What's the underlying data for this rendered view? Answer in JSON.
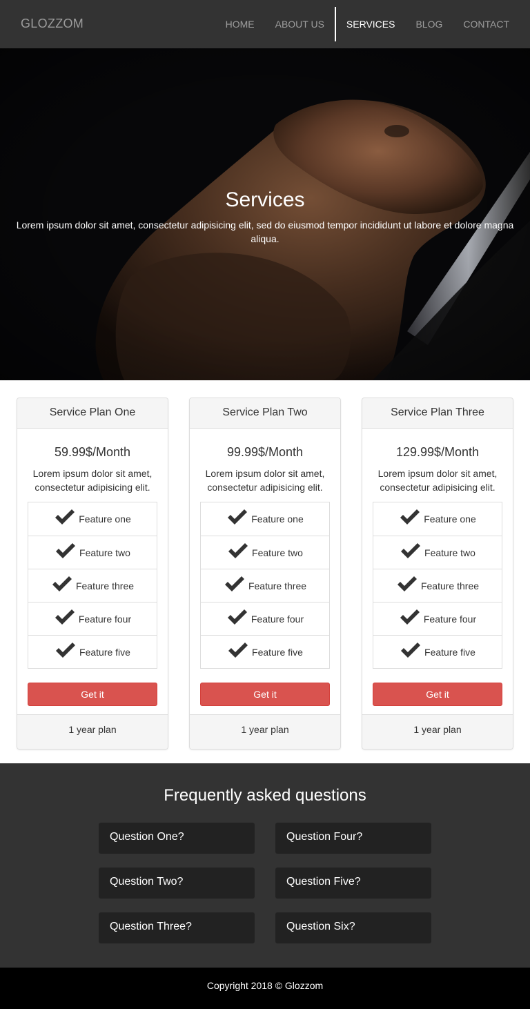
{
  "navbar": {
    "brand": "GLOZZOM",
    "items": [
      {
        "label": "HOME"
      },
      {
        "label": "ABOUT US"
      },
      {
        "label": "SERVICES",
        "active": true
      },
      {
        "label": "BLOG"
      },
      {
        "label": "CONTACT"
      }
    ]
  },
  "hero": {
    "title": "Services",
    "description": "Lorem ipsum dolor sit amet, consectetur adipisicing elit, sed do eiusmod tempor incididunt ut labore et dolore magna aliqua."
  },
  "plans": [
    {
      "title": "Service Plan One",
      "price": "59.99$/Month",
      "description": "Lorem ipsum dolor sit amet, consectetur adipisicing elit.",
      "features": [
        "Feature one",
        "Feature two",
        "Feature three",
        "Feature four",
        "Feature five"
      ],
      "button": "Get it",
      "footer": "1 year plan"
    },
    {
      "title": "Service Plan Two",
      "price": "99.99$/Month",
      "description": "Lorem ipsum dolor sit amet, consectetur adipisicing elit.",
      "features": [
        "Feature one",
        "Feature two",
        "Feature three",
        "Feature four",
        "Feature five"
      ],
      "button": "Get it",
      "footer": "1 year plan"
    },
    {
      "title": "Service Plan Three",
      "price": "129.99$/Month",
      "description": "Lorem ipsum dolor sit amet, consectetur adipisicing elit.",
      "features": [
        "Feature one",
        "Feature two",
        "Feature three",
        "Feature four",
        "Feature five"
      ],
      "button": "Get it",
      "footer": "1 year plan"
    }
  ],
  "faq": {
    "title": "Frequently asked questions",
    "questions": [
      "Question One?",
      "Question Four?",
      "Question Two?",
      "Question Five?",
      "Question Three?",
      "Question Six?"
    ]
  },
  "footer": {
    "copyright": "Copyright 2018 © Glozzom"
  },
  "icons": {
    "feature": "check-icon"
  },
  "colors": {
    "navbar_bg": "#333333",
    "button_red": "#d9534f",
    "faq_bg": "#333333",
    "question_bg": "#222222",
    "footer_bg": "#000000"
  }
}
